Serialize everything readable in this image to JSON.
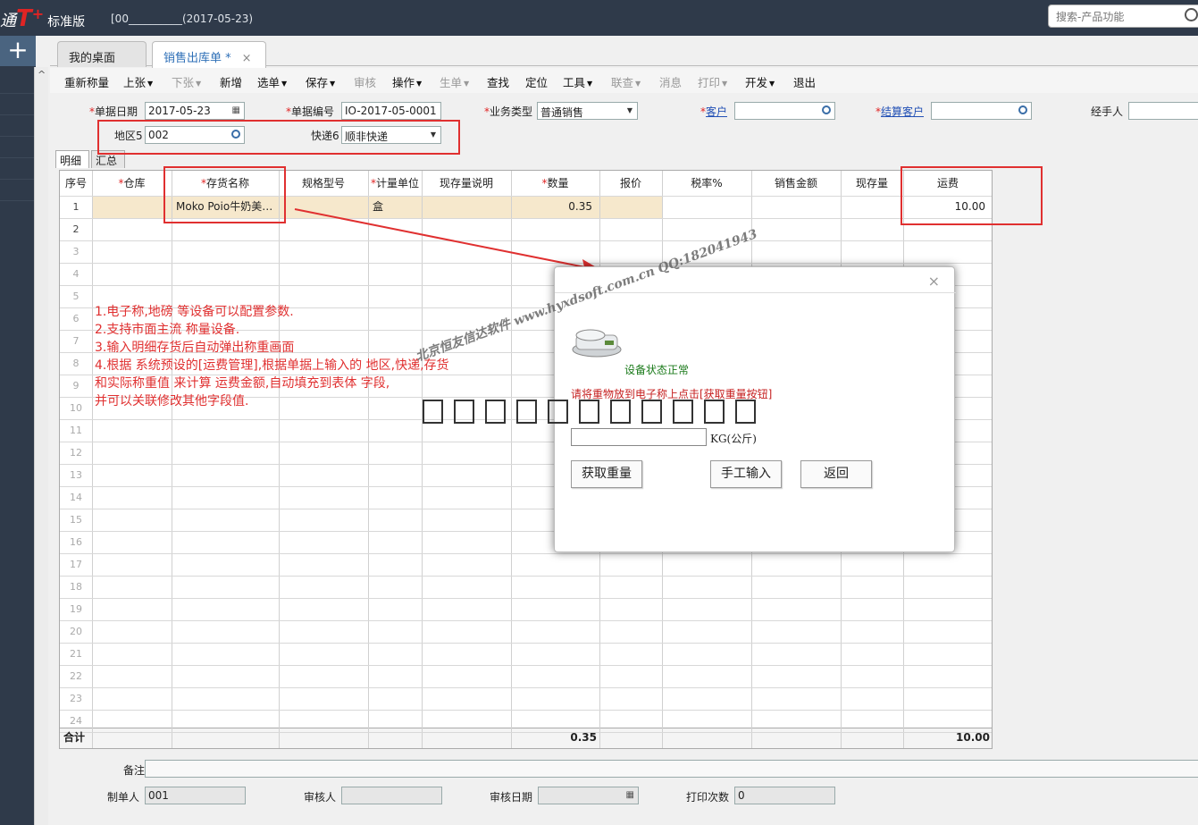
{
  "header": {
    "logo_prefix": "通",
    "logo_brand": "T",
    "logo_plus": "+",
    "edition": "标准版",
    "account": "[00__________(2017-05-23)",
    "search_placeholder": "搜索-产品功能"
  },
  "tabs": [
    {
      "label": "我的桌面"
    },
    {
      "label": "销售出库单 *"
    }
  ],
  "toolbar": [
    {
      "label": "重新称量",
      "arrow": false,
      "disabled": false
    },
    {
      "label": "上张",
      "arrow": true,
      "disabled": false
    },
    {
      "label": "下张",
      "arrow": true,
      "disabled": true
    },
    {
      "label": "新增",
      "arrow": false,
      "disabled": false
    },
    {
      "label": "选单",
      "arrow": true,
      "disabled": false
    },
    {
      "label": "保存",
      "arrow": true,
      "disabled": false
    },
    {
      "label": "审核",
      "arrow": false,
      "disabled": true
    },
    {
      "label": "操作",
      "arrow": true,
      "disabled": false
    },
    {
      "label": "生单",
      "arrow": true,
      "disabled": true
    },
    {
      "label": "查找",
      "arrow": false,
      "disabled": false
    },
    {
      "label": "定位",
      "arrow": false,
      "disabled": false
    },
    {
      "label": "工具",
      "arrow": true,
      "disabled": false
    },
    {
      "label": "联查",
      "arrow": true,
      "disabled": true
    },
    {
      "label": "消息",
      "arrow": false,
      "disabled": true
    },
    {
      "label": "打印",
      "arrow": true,
      "disabled": true
    },
    {
      "label": "开发",
      "arrow": true,
      "disabled": false
    },
    {
      "label": "退出",
      "arrow": false,
      "disabled": false
    }
  ],
  "form": {
    "date_label": "单据日期",
    "date_value": "2017-05-23",
    "code_label": "单据编号",
    "code_value": "IO-2017-05-0001",
    "biztype_label": "业务类型",
    "biztype_value": "普通销售",
    "customer_label": "客户",
    "customer_value": "",
    "settle_label": "结算客户",
    "settle_value": "",
    "handler_label": "经手人",
    "handler_value": "",
    "region_label": "地区5",
    "region_value": "002",
    "express_label": "快递6",
    "express_value": "顺非快递"
  },
  "subtabs": [
    "明细",
    "汇总"
  ],
  "grid": {
    "columns": [
      "序号",
      "仓库",
      "存货名称",
      "规格型号",
      "计量单位",
      "现存量说明",
      "数量",
      "报价",
      "税率%",
      "销售金额",
      "现存量",
      "运费"
    ],
    "required": [
      "仓库",
      "存货名称",
      "计量单位",
      "数量"
    ],
    "row1": {
      "no": "1",
      "name": "Moko Poio牛奶美…",
      "unit": "盒",
      "qty": "0.35",
      "freight": "10.00"
    },
    "row_numbers": [
      "1",
      "2",
      "3",
      "4",
      "5",
      "6",
      "7",
      "8",
      "9",
      "10",
      "11",
      "12",
      "13",
      "14",
      "15",
      "16",
      "17",
      "18",
      "19",
      "20",
      "21",
      "22",
      "23",
      "24"
    ],
    "total_label": "合计",
    "total_qty": "0.35",
    "total_freight": "10.00"
  },
  "footer": {
    "remark_label": "备注",
    "remark_value": "",
    "maker_label": "制单人",
    "maker_value": "001",
    "auditor_label": "审核人",
    "auditor_value": "",
    "audit_date_label": "审核日期",
    "audit_date_value": "",
    "print_count_label": "打印次数",
    "print_count_value": "0"
  },
  "notes": [
    "1.电子称,地磅 等设备可以配置参数.",
    "2.支持市面主流 称量设备.",
    "3.输入明细存货后自动弹出称重画面",
    "4.根据 系统预设的[运费管理],根据单据上输入的 地区,快递,存货",
    "   和实际称重值 来计算 运费金额,自动填充到表体 字段,",
    "   并可以关联修改其他字段值."
  ],
  "dialog": {
    "status": "设备状态正常",
    "prompt": "请将重物放到电子称上点击[获取重量按钮]",
    "weight_value": "",
    "unit": "KG(公斤)",
    "btn_get": "获取重量",
    "btn_manual": "手工输入",
    "btn_back": "返回"
  },
  "watermark": "北京恒友信达软件 www.hyxdsoft.com.cn  QQ:182041943",
  "colors": {
    "accent": "#2e6fb7",
    "annotation": "#e03030",
    "topbar": "#2f3a4a",
    "row_highlight": "#f6e8cc"
  }
}
